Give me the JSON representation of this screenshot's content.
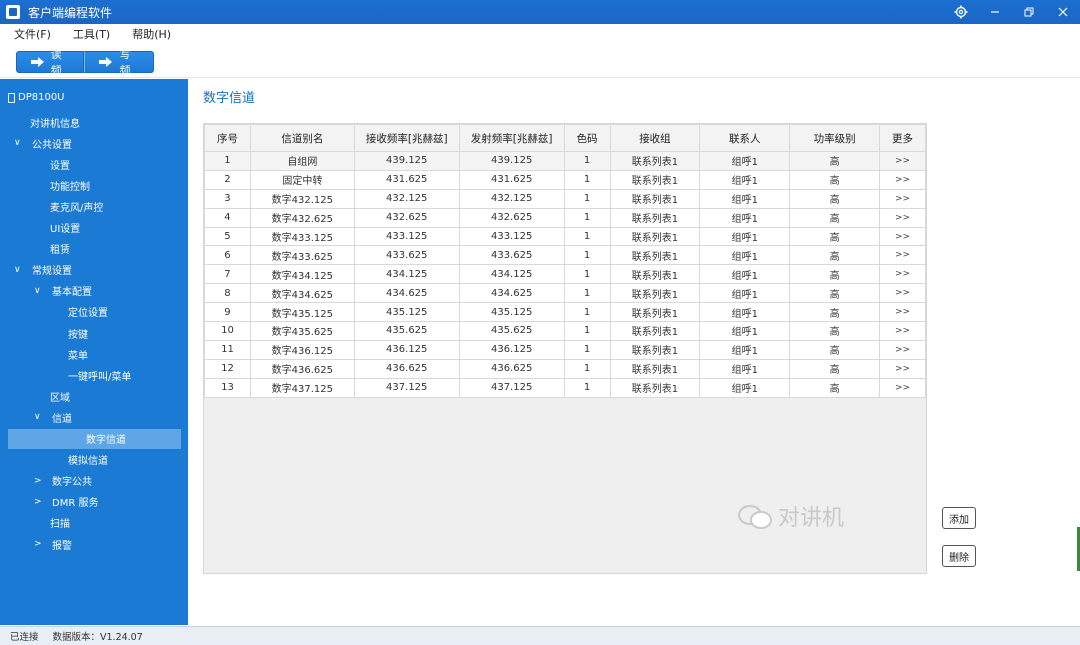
{
  "window": {
    "title": "客户端编程软件",
    "controls": [
      "gear-icon",
      "minimize-icon",
      "restore-icon",
      "close-icon"
    ]
  },
  "menu": [
    "文件(F)",
    "工具(T)",
    "帮助(H)"
  ],
  "toolbar": {
    "read_label": "读频",
    "write_label": "写频"
  },
  "sidebar": {
    "device": "DP8100U",
    "items": [
      {
        "label": "对讲机信息",
        "indent": 0,
        "chevron": ""
      },
      {
        "label": "公共设置",
        "indent": 0,
        "chevron": "∨"
      },
      {
        "label": "设置",
        "indent": 1,
        "chevron": ""
      },
      {
        "label": "功能控制",
        "indent": 1,
        "chevron": ""
      },
      {
        "label": "麦克风/声控",
        "indent": 1,
        "chevron": ""
      },
      {
        "label": "UI设置",
        "indent": 1,
        "chevron": ""
      },
      {
        "label": "租赁",
        "indent": 1,
        "chevron": ""
      },
      {
        "label": "常规设置",
        "indent": 0,
        "chevron": "∨"
      },
      {
        "label": "基本配置",
        "indent": 1,
        "chevron": "∨"
      },
      {
        "label": "定位设置",
        "indent": 2,
        "chevron": ""
      },
      {
        "label": "按键",
        "indent": 2,
        "chevron": ""
      },
      {
        "label": "菜单",
        "indent": 2,
        "chevron": ""
      },
      {
        "label": "一键呼叫/菜单",
        "indent": 2,
        "chevron": ""
      },
      {
        "label": "区域",
        "indent": 1,
        "chevron": ""
      },
      {
        "label": "信道",
        "indent": 1,
        "chevron": "∨"
      },
      {
        "label": "数字信道",
        "indent": 2,
        "chevron": "",
        "selected": true
      },
      {
        "label": "模拟信道",
        "indent": 2,
        "chevron": ""
      },
      {
        "label": "数字公共",
        "indent": 1,
        "chevron": ">"
      },
      {
        "label": "DMR 服务",
        "indent": 1,
        "chevron": ">"
      },
      {
        "label": "扫描",
        "indent": 1,
        "chevron": ""
      },
      {
        "label": "报警",
        "indent": 1,
        "chevron": ">"
      }
    ]
  },
  "main": {
    "title": "数字信道",
    "columns": [
      "序号",
      "信道别名",
      "接收频率[兆赫兹]",
      "发射频率[兆赫兹]",
      "色码",
      "接收组",
      "联系人",
      "功率级别",
      "更多"
    ],
    "rows": [
      [
        "1",
        "自组网",
        "439.125",
        "439.125",
        "1",
        "联系列表1",
        "组呼1",
        "高",
        ">>"
      ],
      [
        "2",
        "固定中转",
        "431.625",
        "431.625",
        "1",
        "联系列表1",
        "组呼1",
        "高",
        ">>"
      ],
      [
        "3",
        "数字432.125",
        "432.125",
        "432.125",
        "1",
        "联系列表1",
        "组呼1",
        "高",
        ">>"
      ],
      [
        "4",
        "数字432.625",
        "432.625",
        "432.625",
        "1",
        "联系列表1",
        "组呼1",
        "高",
        ">>"
      ],
      [
        "5",
        "数字433.125",
        "433.125",
        "433.125",
        "1",
        "联系列表1",
        "组呼1",
        "高",
        ">>"
      ],
      [
        "6",
        "数字433.625",
        "433.625",
        "433.625",
        "1",
        "联系列表1",
        "组呼1",
        "高",
        ">>"
      ],
      [
        "7",
        "数字434.125",
        "434.125",
        "434.125",
        "1",
        "联系列表1",
        "组呼1",
        "高",
        ">>"
      ],
      [
        "8",
        "数字434.625",
        "434.625",
        "434.625",
        "1",
        "联系列表1",
        "组呼1",
        "高",
        ">>"
      ],
      [
        "9",
        "数字435.125",
        "435.125",
        "435.125",
        "1",
        "联系列表1",
        "组呼1",
        "高",
        ">>"
      ],
      [
        "10",
        "数字435.625",
        "435.625",
        "435.625",
        "1",
        "联系列表1",
        "组呼1",
        "高",
        ">>"
      ],
      [
        "11",
        "数字436.125",
        "436.125",
        "436.125",
        "1",
        "联系列表1",
        "组呼1",
        "高",
        ">>"
      ],
      [
        "12",
        "数字436.625",
        "436.625",
        "436.625",
        "1",
        "联系列表1",
        "组呼1",
        "高",
        ">>"
      ],
      [
        "13",
        "数字437.125",
        "437.125",
        "437.125",
        "1",
        "联系列表1",
        "组呼1",
        "高",
        ">>"
      ]
    ],
    "add_label": "添加",
    "delete_label": "删除"
  },
  "watermark": "对讲机",
  "status": {
    "connection": "已连接",
    "version": "数据版本：V1.24.07"
  },
  "colors": {
    "titlebar": "#1a66c4",
    "sidebar": "#1a7ad4",
    "selected": "#5fa6e6",
    "accent_text": "#1a6fc7"
  }
}
